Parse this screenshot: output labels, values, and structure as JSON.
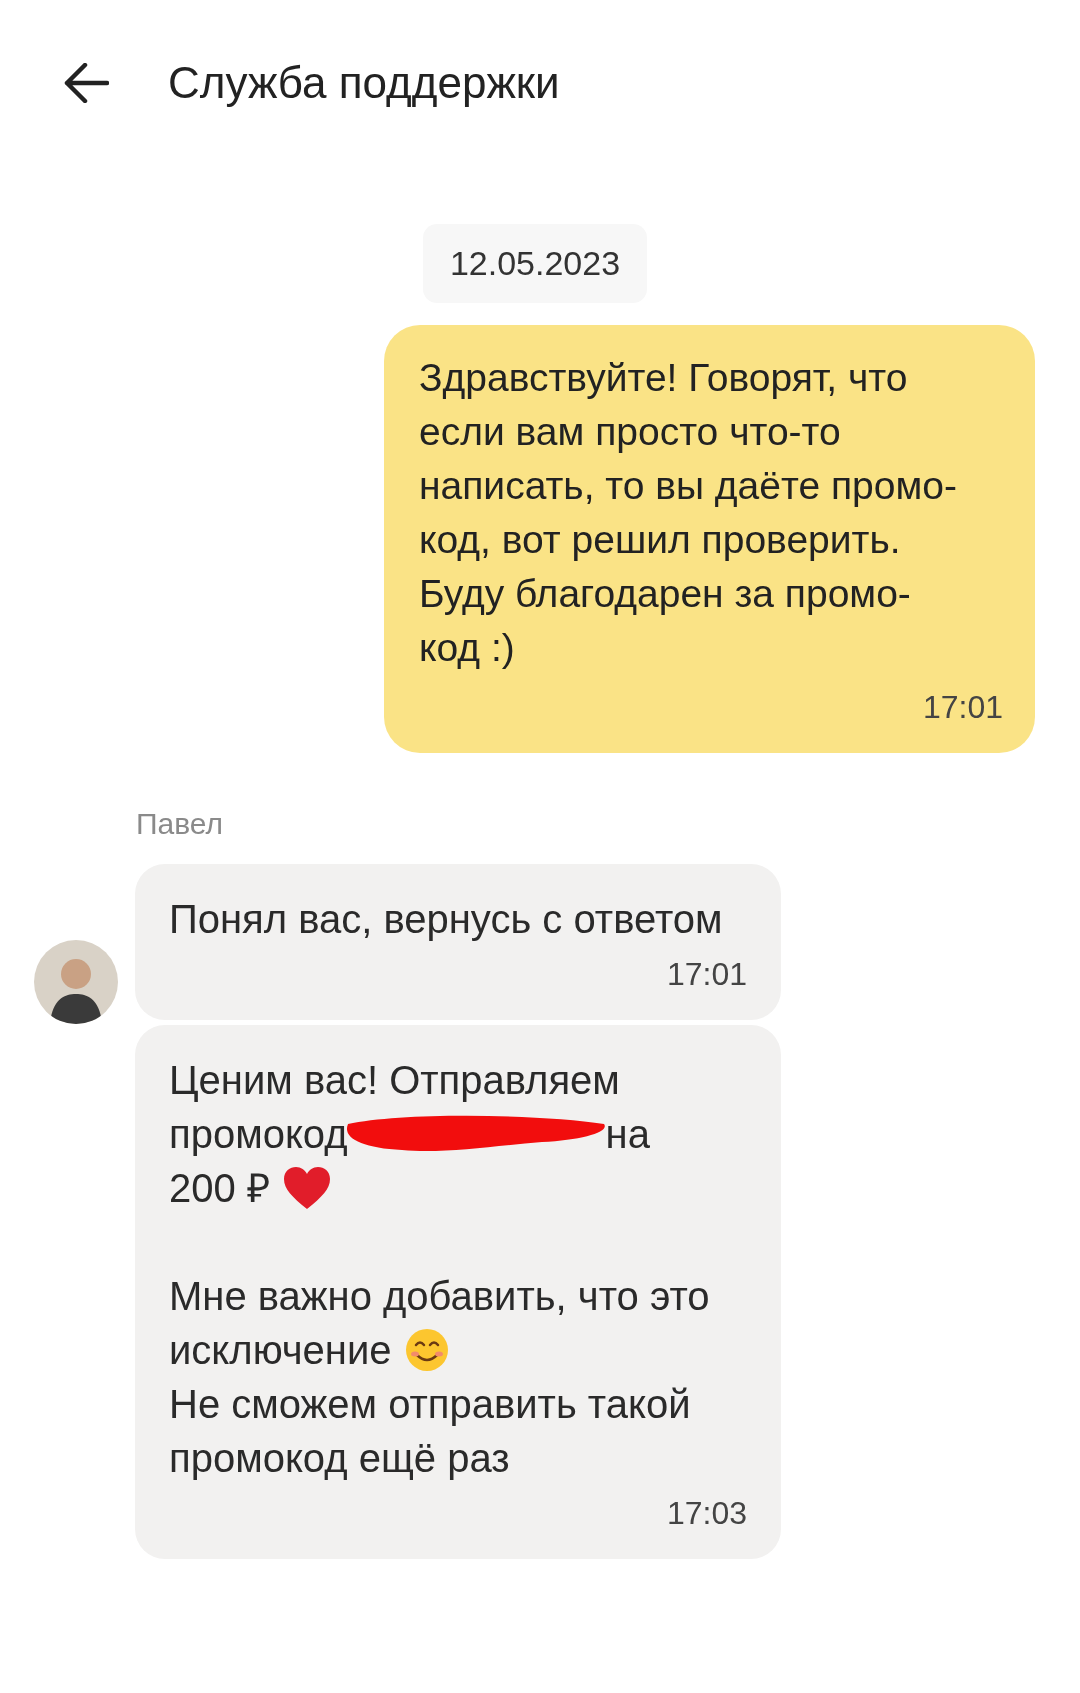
{
  "header": {
    "title": "Служба поддержки"
  },
  "date": "12.05.2023",
  "messages": [
    {
      "kind": "outgoing",
      "lines": [
        {
          "kind": "plain",
          "text": "Здравствуйте! Говорят, что"
        },
        {
          "kind": "plain",
          "text": "если вам просто что-то"
        },
        {
          "kind": "plain",
          "text": "написать, то вы даёте промо-"
        },
        {
          "kind": "plain",
          "text": "код, вот решил проверить."
        },
        {
          "kind": "plain",
          "text": "Буду благодарен за промо-"
        },
        {
          "kind": "plain",
          "text": "код :)"
        }
      ],
      "time": "17:01"
    },
    {
      "kind": "incoming",
      "sender": "Павел",
      "lines": [
        {
          "kind": "plain",
          "text": "Понял вас, вернусь с ответом"
        }
      ],
      "time": "17:01"
    },
    {
      "kind": "incoming",
      "lines": [
        {
          "kind": "plain",
          "text": "Ценим вас! Отправляем"
        },
        {
          "kind": "redacted",
          "text": "промокод",
          "after": "на"
        },
        {
          "kind": "with_heart",
          "text": "200 ₽"
        },
        {
          "kind": "gap"
        },
        {
          "kind": "plain",
          "text": "Мне важно добавить, что это"
        },
        {
          "kind": "with_smiley",
          "text": "исключение"
        },
        {
          "kind": "plain",
          "text": "Не сможем отправить такой"
        },
        {
          "kind": "plain",
          "text": "промокод ещё раз"
        }
      ],
      "time": "17:03"
    }
  ]
}
